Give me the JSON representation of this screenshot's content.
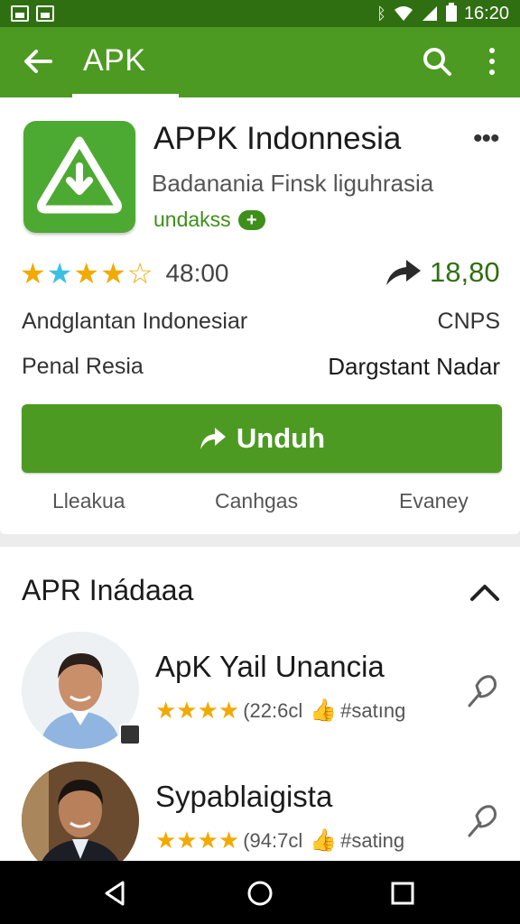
{
  "status_bar": {
    "time": "16:20",
    "icons": [
      "gallery-icon",
      "image-icon",
      "bluetooth-icon",
      "wifi-icon",
      "signal-icon",
      "battery-icon"
    ]
  },
  "app_bar": {
    "title": "APK",
    "back_icon": "arrow-left-icon",
    "search_icon": "search-icon",
    "menu_icon": "more-vertical-icon"
  },
  "app": {
    "name": "APPK Indonnesia",
    "subtitle": "Badanania  Finsk liguhrasia",
    "tag": "undakss",
    "rating": {
      "stars": 4.5,
      "value": "48:00"
    },
    "trend_value": "18,80",
    "info": [
      {
        "left": "Andglantan Indonesiar",
        "right": "CNPS"
      },
      {
        "left": "Penal Resia",
        "right": "Dargstant Nadar"
      }
    ],
    "install_label": "Unduh",
    "sub_links": [
      "Lleakua",
      "Canhgas",
      "Evaney"
    ]
  },
  "section": {
    "title": "APR Inádaaa",
    "items": [
      {
        "name": "ApK Yail Unancia",
        "count": "(22:6cl",
        "tag": "#satıng"
      },
      {
        "name": "Sypablaigista",
        "count": "(94:7cl",
        "tag": "#sating"
      }
    ]
  },
  "colors": {
    "primary": "#4c9a22",
    "primary_dark": "#2f6f12",
    "star": "#f2a900",
    "star_alt": "#3cc0e0"
  }
}
